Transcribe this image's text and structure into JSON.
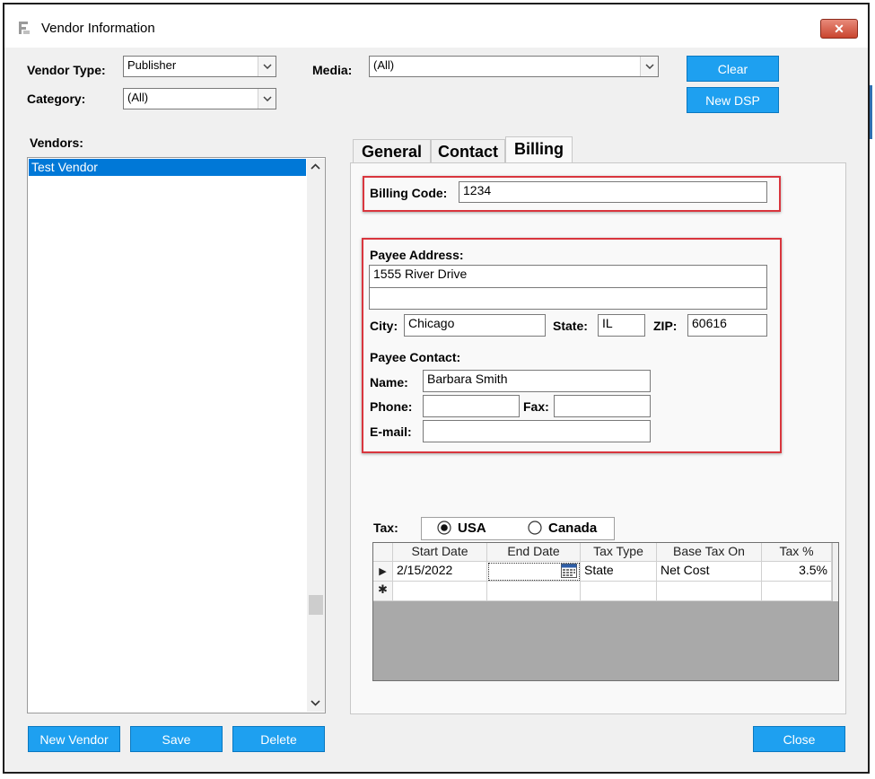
{
  "window": {
    "title": "Vendor Information",
    "close_symbol": "✕"
  },
  "filters": {
    "vendor_type_label": "Vendor Type:",
    "vendor_type_value": "Publisher",
    "category_label": "Category:",
    "category_value": "(All)",
    "media_label": "Media:",
    "media_value": "(All)",
    "clear_label": "Clear",
    "new_dsp_label": "New DSP"
  },
  "vendors": {
    "label": "Vendors:",
    "items": [
      "Test Vendor"
    ],
    "new_vendor_label": "New Vendor",
    "save_label": "Save",
    "delete_label": "Delete"
  },
  "tabs": [
    "General",
    "Contact",
    "Billing"
  ],
  "billing": {
    "billing_code_label": "Billing Code:",
    "billing_code_value": "1234",
    "payee_address_label": "Payee Address:",
    "address_line1": "1555 River Drive",
    "address_line2": "",
    "city_label": "City:",
    "city_value": "Chicago",
    "state_label": "State:",
    "state_value": "IL",
    "zip_label": "ZIP:",
    "zip_value": "60616",
    "payee_contact_label": "Payee Contact:",
    "name_label": "Name:",
    "name_value": "Barbara Smith",
    "phone_label": "Phone:",
    "phone_value": "",
    "fax_label": "Fax:",
    "fax_value": "",
    "email_label": "E-mail:",
    "email_value": ""
  },
  "tax": {
    "label": "Tax:",
    "options": [
      "USA",
      "Canada"
    ],
    "selected": "USA",
    "columns": [
      "Start Date",
      "End Date",
      "Tax Type",
      "Base Tax On",
      "Tax %"
    ],
    "rows": [
      {
        "start_date": "2/15/2022",
        "end_date": "",
        "tax_type": "State",
        "base_tax_on": "Net Cost",
        "tax_pct": "3.5%"
      }
    ],
    "current_row_marker": "▶",
    "new_row_marker": "✱"
  },
  "footer": {
    "close_label": "Close"
  },
  "colors": {
    "accent": "#1ea0f0",
    "highlight_box": "#d9363e",
    "selection": "#0078d7"
  }
}
